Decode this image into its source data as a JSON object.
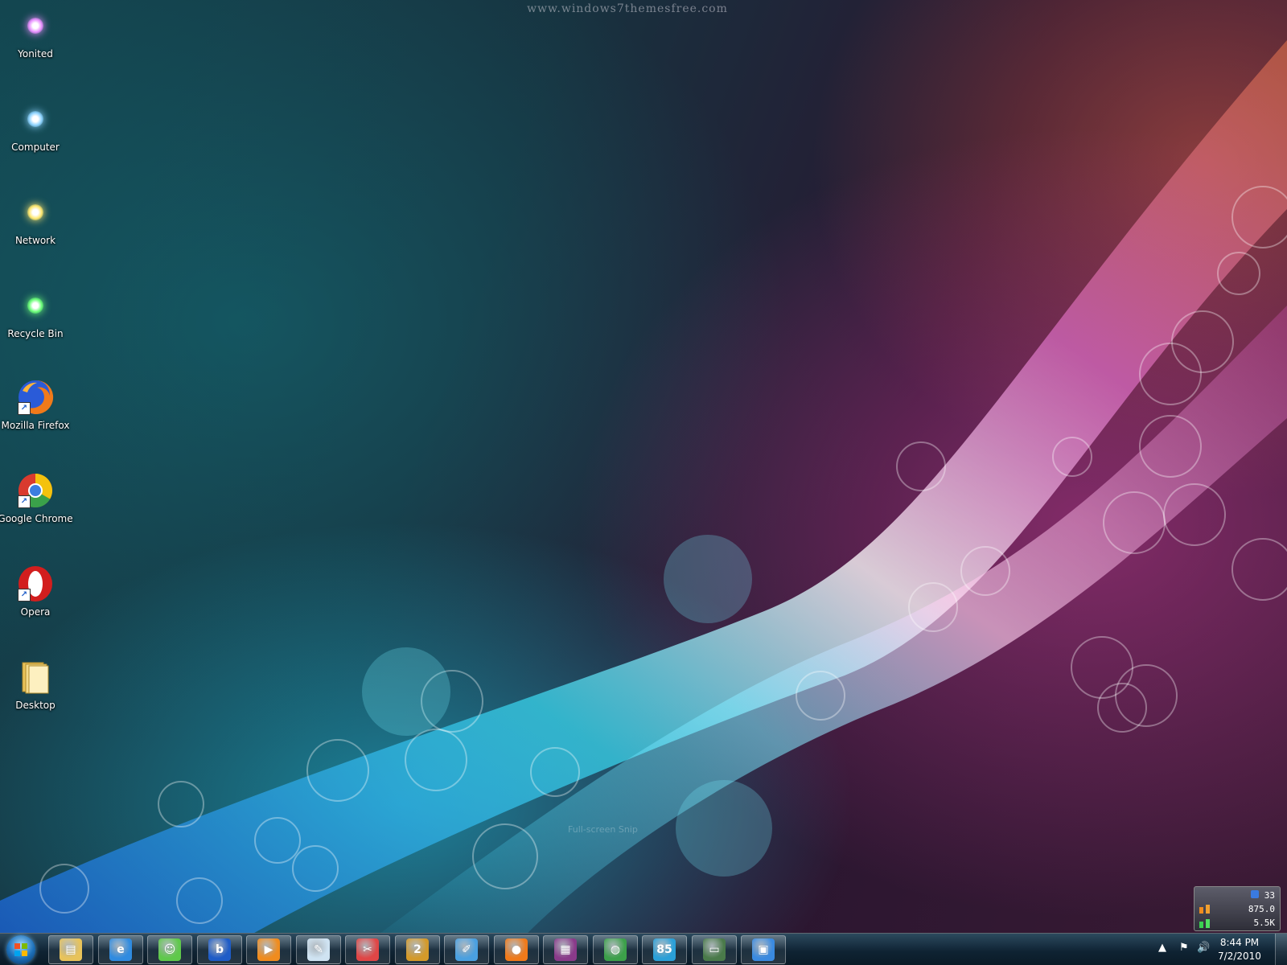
{
  "wallpaper": {
    "watermark": "www.windows7themesfree.com",
    "overlay_text": "Full-screen Snip"
  },
  "desktop_icons": [
    {
      "label": "Yonited",
      "icon": "purple-orb-icon",
      "color": "#e890ff"
    },
    {
      "label": "Computer",
      "icon": "blue-orb-icon",
      "color": "#8fd4ff"
    },
    {
      "label": "Network",
      "icon": "yellow-orb-icon",
      "color": "#ffe870"
    },
    {
      "label": "Recycle Bin",
      "icon": "green-orb-icon",
      "color": "#6dff7a"
    },
    {
      "label": "Mozilla Firefox",
      "icon": "firefox-icon",
      "color": "#f07a1a"
    },
    {
      "label": "Google Chrome",
      "icon": "chrome-icon",
      "color": "#3b7de0"
    },
    {
      "label": "Opera",
      "icon": "opera-icon",
      "color": "#d21e1e"
    },
    {
      "label": "Desktop",
      "icon": "folder-icon",
      "color": "#f4dc8c"
    }
  ],
  "taskbar": {
    "pinned": [
      {
        "name": "windows-explorer",
        "icon": "folder-icon",
        "color": "#e8c35a"
      },
      {
        "name": "internet-explorer",
        "icon": "ie-icon",
        "color": "#2f8be0"
      },
      {
        "name": "messenger",
        "icon": "messenger-icon",
        "color": "#5fc94b"
      },
      {
        "name": "bing",
        "icon": "bing-icon",
        "color": "#1e5cc7"
      },
      {
        "name": "media-player",
        "icon": "media-player-icon",
        "color": "#f08c1e"
      },
      {
        "name": "notepad",
        "icon": "notepad-icon",
        "color": "#cfe3f2"
      },
      {
        "name": "snipping-tool",
        "icon": "scissors-icon",
        "color": "#e04646"
      },
      {
        "name": "game-2",
        "icon": "game-2-icon",
        "color": "#d49a2a"
      },
      {
        "name": "paint",
        "icon": "paint-icon",
        "color": "#4aa0e0"
      },
      {
        "name": "firefox",
        "icon": "firefox-icon",
        "color": "#f07a1a"
      },
      {
        "name": "winrar",
        "icon": "winrar-icon",
        "color": "#8a3a8a"
      },
      {
        "name": "network-globe",
        "icon": "globe-icon",
        "color": "#3ca04a"
      },
      {
        "name": "speedtest",
        "icon": "speed-85-icon",
        "color": "#2aa0d8"
      },
      {
        "name": "task-manager",
        "icon": "monitor-icon",
        "color": "#4a7a4a"
      },
      {
        "name": "control-panel",
        "icon": "control-panel-icon",
        "color": "#3a8ae0"
      }
    ],
    "clock": {
      "time": "8:44 PM",
      "date": "7/2/2010"
    },
    "tray_icons": [
      "show-hidden-icon",
      "action-center-flag-icon",
      "volume-icon"
    ]
  },
  "gadget": {
    "value_top": "33",
    "value_mid": "875.0",
    "value_bottom": "5.5K"
  }
}
